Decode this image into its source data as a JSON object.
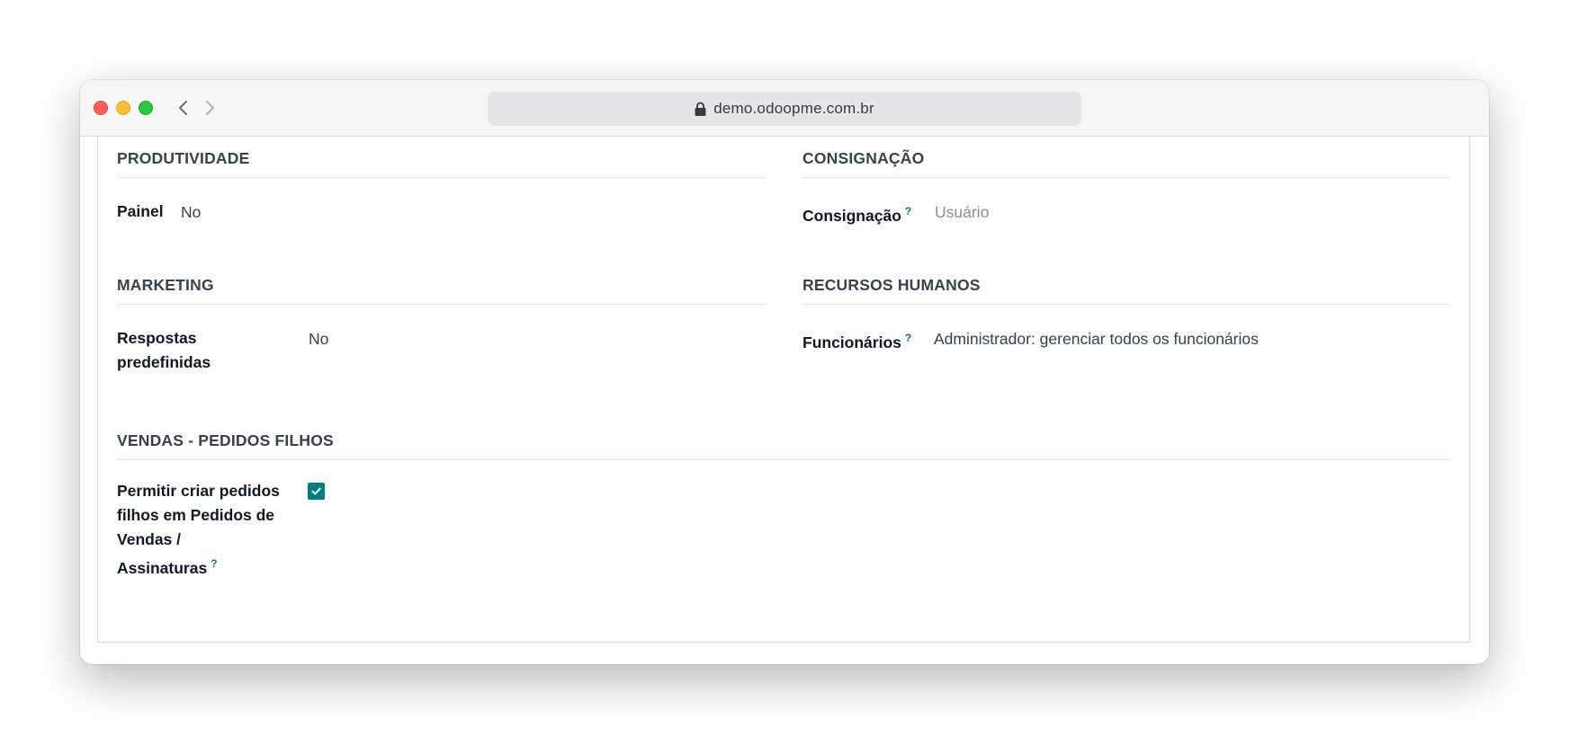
{
  "browser": {
    "url": "demo.odoopme.com.br"
  },
  "sections": {
    "produtividade": {
      "title": "PRODUTIVIDADE",
      "field_label": "Painel",
      "field_value": "No"
    },
    "consignacao": {
      "title": "CONSIGNAÇÃO",
      "field_label": "Consignação",
      "help": "?",
      "field_placeholder": "Usuário"
    },
    "marketing": {
      "title": "MARKETING",
      "field_label_line1": "Respostas",
      "field_label_line2": "predefinidas",
      "field_value": "No"
    },
    "recursos_humanos": {
      "title": "RECURSOS HUMANOS",
      "field_label": "Funcionários",
      "help": "?",
      "field_value": "Administrador: gerenciar todos os funcionários"
    },
    "vendas_pedidos_filhos": {
      "title": "VENDAS - PEDIDOS FILHOS",
      "field_label_line1": "Permitir criar pedidos",
      "field_label_line2": "filhos em Pedidos de",
      "field_label_line3": "Vendas /",
      "field_label_line4": "Assinaturas",
      "help": "?",
      "checked": true
    }
  },
  "colors": {
    "accent": "#017e84",
    "close": "#ff5f57",
    "minimize": "#febc2e",
    "zoom": "#28c840"
  }
}
